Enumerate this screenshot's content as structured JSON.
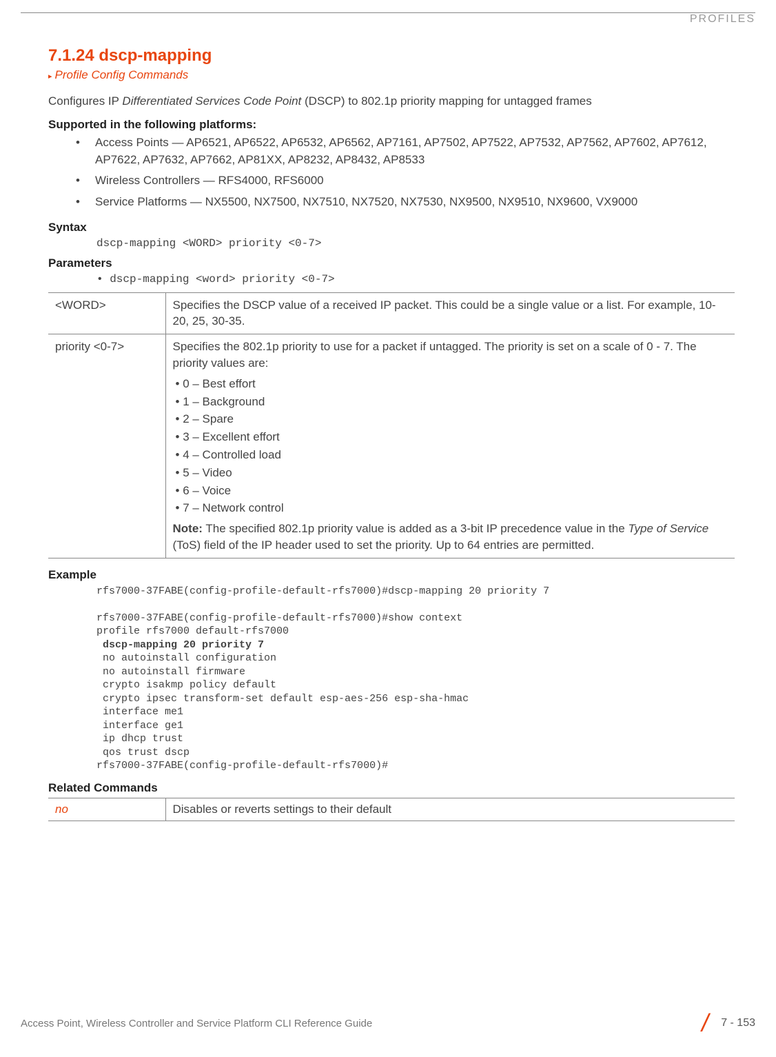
{
  "header": {
    "label": "PROFILES"
  },
  "section": {
    "title": "7.1.24 dscp-mapping",
    "breadcrumb": "Profile Config Commands",
    "intro_pre": "Configures IP ",
    "intro_italic": "Differentiated Services Code Point",
    "intro_post": " (DSCP) to 802.1p priority mapping for untagged frames"
  },
  "platforms": {
    "heading": "Supported in the following platforms:",
    "items": [
      "Access Points — AP6521, AP6522, AP6532, AP6562, AP7161, AP7502, AP7522, AP7532, AP7562, AP7602, AP7612, AP7622, AP7632, AP7662, AP81XX, AP8232, AP8432, AP8533",
      "Wireless Controllers — RFS4000, RFS6000",
      "Service Platforms — NX5500, NX7500, NX7510, NX7520, NX7530, NX9500, NX9510, NX9600, VX9000"
    ]
  },
  "syntax": {
    "heading": "Syntax",
    "code": "dscp-mapping <WORD> priority <0-7>"
  },
  "parameters": {
    "heading": "Parameters",
    "intro": "• dscp-mapping <word> priority <0-7>",
    "rows": [
      {
        "name": "<WORD>",
        "desc": "Specifies the DSCP value of a received IP packet. This could be a single value or a list. For example, 10-20, 25, 30-35."
      },
      {
        "name": "priority <0-7>",
        "desc_intro": "Specifies the 802.1p priority to use for a packet if untagged. The priority is set on a scale of 0 - 7. The priority values are:",
        "values": [
          "0 – Best effort",
          "1 – Background",
          "2 – Spare",
          "3 – Excellent effort",
          "4 – Controlled load",
          "5 – Video",
          "6 – Voice",
          "7 – Network control"
        ],
        "note_label": "Note:",
        "note_pre": " The specified 802.1p priority value is added as a 3-bit IP precedence value in the ",
        "note_italic": "Type of Service",
        "note_post": " (ToS) field of the IP header used to set the priority. Up to 64 entries are permitted."
      }
    ]
  },
  "example": {
    "heading": "Example",
    "line1": "rfs7000-37FABE(config-profile-default-rfs7000)#dscp-mapping 20 priority 7",
    "line2": "rfs7000-37FABE(config-profile-default-rfs7000)#show context",
    "line3": "profile rfs7000 default-rfs7000",
    "bold": " dscp-mapping 20 priority 7",
    "rest": " no autoinstall configuration\n no autoinstall firmware\n crypto isakmp policy default\n crypto ipsec transform-set default esp-aes-256 esp-sha-hmac\n interface me1\n interface ge1\n ip dhcp trust\n qos trust dscp\nrfs7000-37FABE(config-profile-default-rfs7000)#"
  },
  "related": {
    "heading": "Related Commands",
    "cmd": "no",
    "desc": "Disables or reverts settings to their default"
  },
  "footer": {
    "left": "Access Point, Wireless Controller and Service Platform CLI Reference Guide",
    "page": "7 - 153"
  }
}
